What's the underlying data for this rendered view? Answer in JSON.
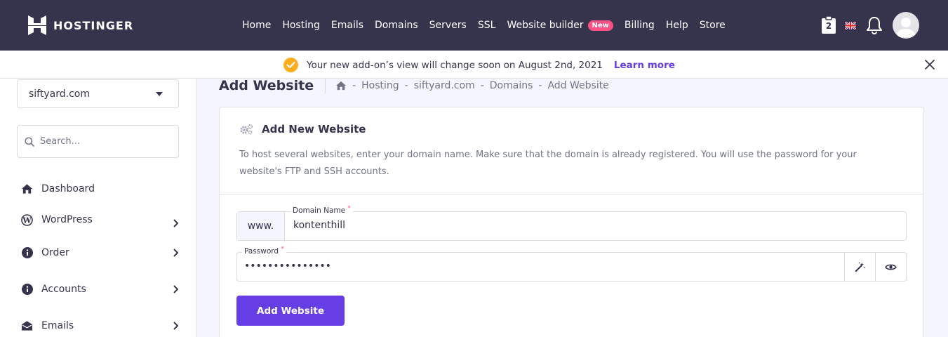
{
  "brand": {
    "name": "HOSTINGER"
  },
  "nav": {
    "items": [
      {
        "label": "Home"
      },
      {
        "label": "Hosting"
      },
      {
        "label": "Emails"
      },
      {
        "label": "Domains"
      },
      {
        "label": "Servers"
      },
      {
        "label": "SSL"
      },
      {
        "label": "Website builder",
        "badge": "New"
      },
      {
        "label": "Billing"
      },
      {
        "label": "Help"
      },
      {
        "label": "Store"
      }
    ]
  },
  "topbar": {
    "cart_count": "2",
    "language": "English (UK)"
  },
  "notice": {
    "text": "Your new add-on’s view will change soon on August 2nd, 2021",
    "link": "Learn more"
  },
  "sidebar": {
    "selected_domain": "siftyard.com",
    "search_placeholder": "Search...",
    "items": [
      {
        "label": "Dashboard",
        "icon": "home-icon"
      },
      {
        "label": "WordPress",
        "icon": "wordpress-icon"
      },
      {
        "label": "Order",
        "icon": "info-icon"
      },
      {
        "label": "Accounts",
        "icon": "info-icon"
      },
      {
        "label": "Emails",
        "icon": "envelope-icon"
      }
    ]
  },
  "page": {
    "title": "Add Website",
    "breadcrumbs": [
      "Hosting",
      "siftyard.com",
      "Domains",
      "Add Website"
    ],
    "breadcrumb_separator": "-"
  },
  "card": {
    "title": "Add New Website",
    "description": "To host several websites, enter your domain name. Make sure that the domain is already registered. You will use the password for your website's FTP and SSH accounts.",
    "domain_prefix": "www.",
    "domain_label": "Domain Name",
    "domain_value": "kontenthill",
    "password_label": "Password",
    "password_value": "•••••••••••••••",
    "required_mark": "*",
    "submit_label": "Add Website"
  },
  "colors": {
    "topbar": "#36344d",
    "accent": "#673de6",
    "new_badge": "#fc5185",
    "notice_check": "#ffad1d"
  }
}
